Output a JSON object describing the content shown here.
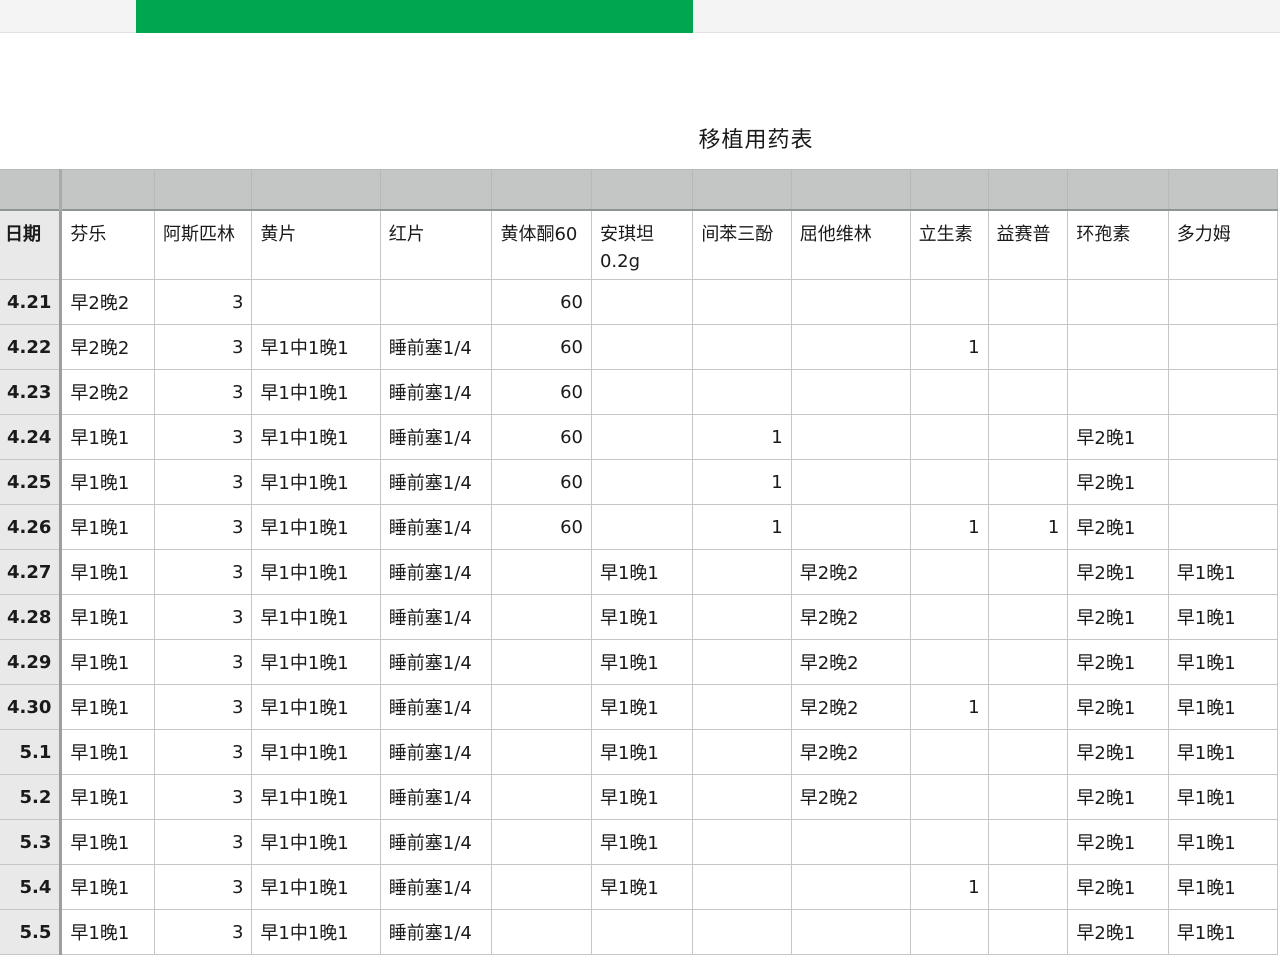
{
  "sheet": {
    "title": "移植用药表",
    "headers": [
      "日期",
      "芬乐",
      "阿斯匹林",
      "黄片",
      "红片",
      "黄体酮60",
      "安琪坦0.2g",
      "间苯三酚",
      "屈他维林",
      "立生素",
      "益赛普",
      "环孢素",
      "多力姆"
    ],
    "rows": [
      [
        "4.21",
        "早2晚2",
        "3",
        "",
        "",
        "60",
        "",
        "",
        "",
        "",
        "",
        "",
        ""
      ],
      [
        "4.22",
        "早2晚2",
        "3",
        "早1中1晚1",
        "睡前塞1/4",
        "60",
        "",
        "",
        "",
        "1",
        "",
        "",
        ""
      ],
      [
        "4.23",
        "早2晚2",
        "3",
        "早1中1晚1",
        "睡前塞1/4",
        "60",
        "",
        "",
        "",
        "",
        "",
        "",
        ""
      ],
      [
        "4.24",
        "早1晚1",
        "3",
        "早1中1晚1",
        "睡前塞1/4",
        "60",
        "",
        "1",
        "",
        "",
        "",
        "早2晚1",
        ""
      ],
      [
        "4.25",
        "早1晚1",
        "3",
        "早1中1晚1",
        "睡前塞1/4",
        "60",
        "",
        "1",
        "",
        "",
        "",
        "早2晚1",
        ""
      ],
      [
        "4.26",
        "早1晚1",
        "3",
        "早1中1晚1",
        "睡前塞1/4",
        "60",
        "",
        "1",
        "",
        "1",
        "1",
        "早2晚1",
        ""
      ],
      [
        "4.27",
        "早1晚1",
        "3",
        "早1中1晚1",
        "睡前塞1/4",
        "",
        "早1晚1",
        "",
        "早2晚2",
        "",
        "",
        "早2晚1",
        "早1晚1"
      ],
      [
        "4.28",
        "早1晚1",
        "3",
        "早1中1晚1",
        "睡前塞1/4",
        "",
        "早1晚1",
        "",
        "早2晚2",
        "",
        "",
        "早2晚1",
        "早1晚1"
      ],
      [
        "4.29",
        "早1晚1",
        "3",
        "早1中1晚1",
        "睡前塞1/4",
        "",
        "早1晚1",
        "",
        "早2晚2",
        "",
        "",
        "早2晚1",
        "早1晚1"
      ],
      [
        "4.30",
        "早1晚1",
        "3",
        "早1中1晚1",
        "睡前塞1/4",
        "",
        "早1晚1",
        "",
        "早2晚2",
        "1",
        "",
        "早2晚1",
        "早1晚1"
      ],
      [
        "5.1",
        "早1晚1",
        "3",
        "早1中1晚1",
        "睡前塞1/4",
        "",
        "早1晚1",
        "",
        "早2晚2",
        "",
        "",
        "早2晚1",
        "早1晚1"
      ],
      [
        "5.2",
        "早1晚1",
        "3",
        "早1中1晚1",
        "睡前塞1/4",
        "",
        "早1晚1",
        "",
        "早2晚2",
        "",
        "",
        "早2晚1",
        "早1晚1"
      ],
      [
        "5.3",
        "早1晚1",
        "3",
        "早1中1晚1",
        "睡前塞1/4",
        "",
        "早1晚1",
        "",
        "",
        "",
        "",
        "早2晚1",
        "早1晚1"
      ],
      [
        "5.4",
        "早1晚1",
        "3",
        "早1中1晚1",
        "睡前塞1/4",
        "",
        "早1晚1",
        "",
        "",
        "1",
        "",
        "早2晚1",
        "早1晚1"
      ],
      [
        "5.5",
        "早1晚1",
        "3",
        "早1中1晚1",
        "睡前塞1/4",
        "",
        "",
        "",
        "",
        "",
        "",
        "早2晚1",
        "早1晚1"
      ]
    ]
  },
  "colors": {
    "accent": "#00a650",
    "header_band": "#c4c6c6",
    "date_column": "#e9e9e9"
  }
}
